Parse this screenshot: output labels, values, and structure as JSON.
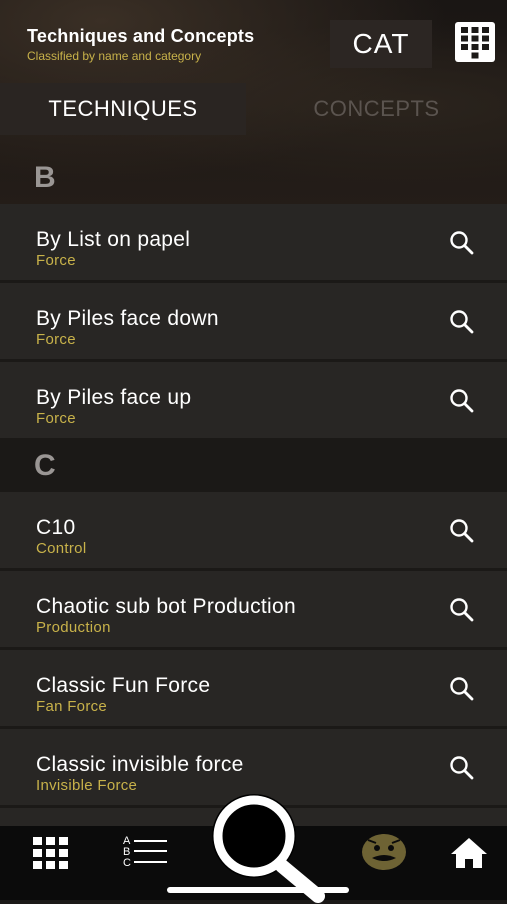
{
  "header": {
    "title": "Techniques and Concepts",
    "subtitle": "Classified by name and category",
    "cat_label": "CAT"
  },
  "tabs": [
    {
      "label": "TECHNIQUES",
      "active": true
    },
    {
      "label": "CONCEPTS",
      "active": false
    }
  ],
  "sections": [
    {
      "letter": "B",
      "items": [
        {
          "name": "By List on papel",
          "category": "Force"
        },
        {
          "name": "By Piles face down",
          "category": "Force"
        },
        {
          "name": "By Piles face up",
          "category": "Force"
        }
      ]
    },
    {
      "letter": "C",
      "items": [
        {
          "name": "C10",
          "category": "Control"
        },
        {
          "name": "Chaotic sub bot Production",
          "category": "Production"
        },
        {
          "name": "Classic Fun Force",
          "category": "Fan Force"
        },
        {
          "name": "Classic invisible force",
          "category": "Invisible Force"
        }
      ]
    }
  ],
  "bottom_nav": {
    "items": [
      "grid-icon",
      "abc-list-icon",
      "search-icon",
      "magician-face-icon",
      "home-icon"
    ]
  },
  "colors": {
    "accent": "#c8b24a",
    "row_bg": "#282624",
    "background": "#1b1917"
  }
}
